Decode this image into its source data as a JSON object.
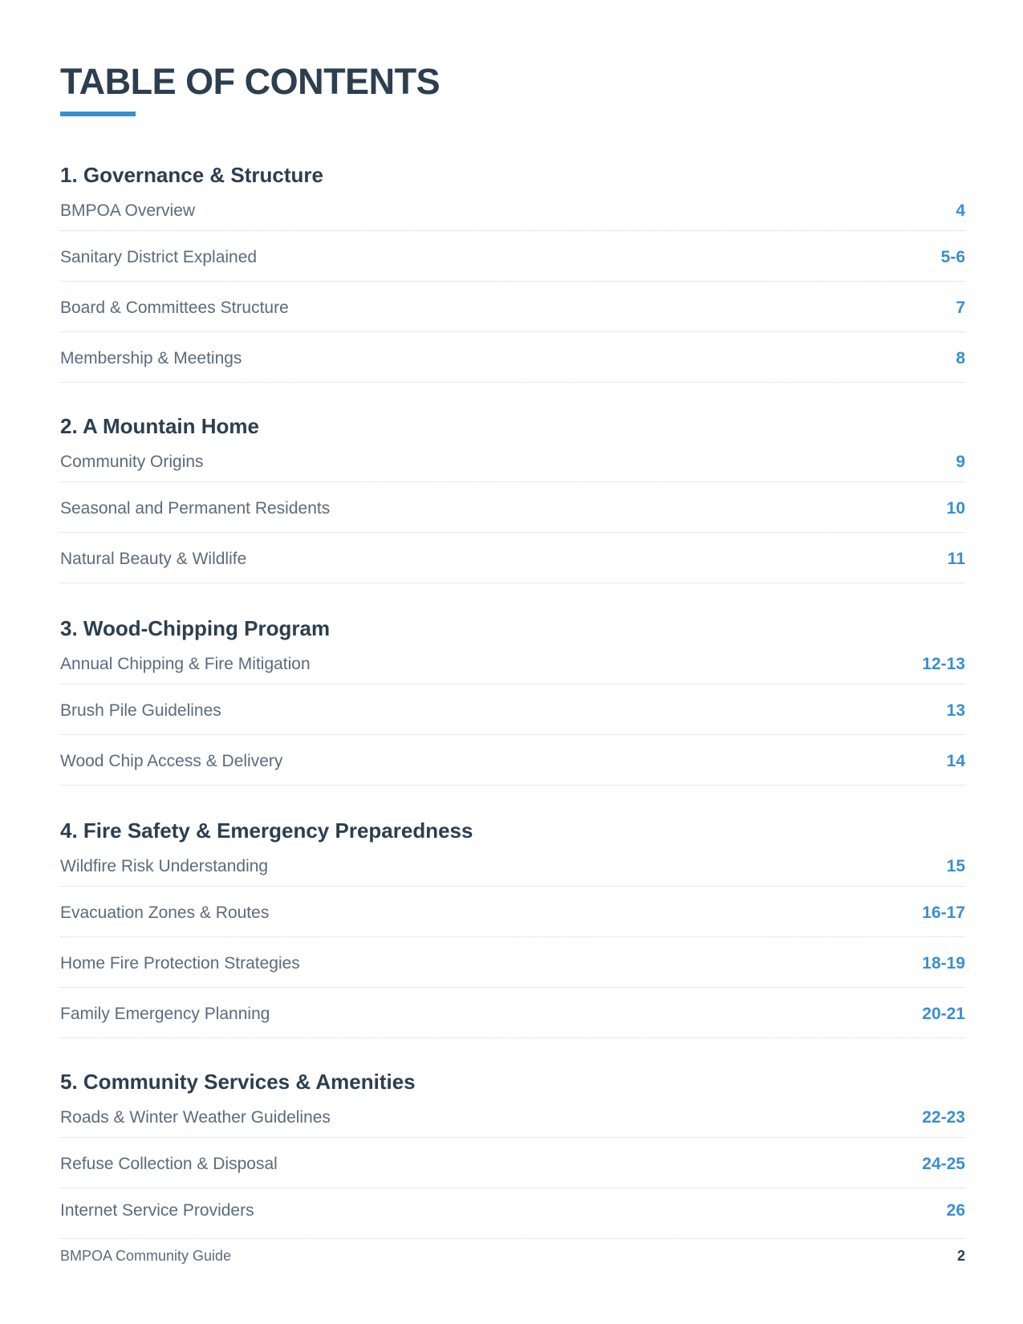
{
  "document": {
    "title": "TABLE OF CONTENTS",
    "accent_color": "#3a8fd0",
    "heading_color": "#2c3e50"
  },
  "sections": [
    {
      "heading": "1. Governance & Structure",
      "entries": [
        {
          "label": "BMPOA Overview",
          "page": "4"
        },
        {
          "label": "Sanitary District Explained",
          "page": "5-6"
        },
        {
          "label": "Board & Committees Structure",
          "page": "7"
        },
        {
          "label": "Membership & Meetings",
          "page": "8"
        }
      ]
    },
    {
      "heading": "2. A Mountain Home",
      "entries": [
        {
          "label": "Community Origins",
          "page": "9"
        },
        {
          "label": "Seasonal and Permanent Residents",
          "page": "10"
        },
        {
          "label": "Natural Beauty & Wildlife",
          "page": "11"
        }
      ]
    },
    {
      "heading": "3. Wood-Chipping Program",
      "entries": [
        {
          "label": "Annual Chipping & Fire Mitigation",
          "page": "12-13"
        },
        {
          "label": "Brush Pile Guidelines",
          "page": "13"
        },
        {
          "label": "Wood Chip Access & Delivery",
          "page": "14"
        }
      ]
    },
    {
      "heading": "4. Fire Safety & Emergency Preparedness",
      "entries": [
        {
          "label": "Wildfire Risk Understanding",
          "page": "15"
        },
        {
          "label": "Evacuation Zones & Routes",
          "page": "16-17"
        },
        {
          "label": "Home Fire Protection Strategies",
          "page": "18-19"
        },
        {
          "label": "Family Emergency Planning",
          "page": "20-21"
        }
      ]
    },
    {
      "heading": "5. Community Services & Amenities",
      "entries": [
        {
          "label": "Roads & Winter Weather Guidelines",
          "page": "22-23"
        },
        {
          "label": "Refuse Collection & Disposal",
          "page": "24-25"
        },
        {
          "label": "Internet Service Providers",
          "page": "26"
        }
      ]
    }
  ],
  "footer": {
    "doc_name": "BMPOA Community Guide",
    "page_number": "2"
  }
}
